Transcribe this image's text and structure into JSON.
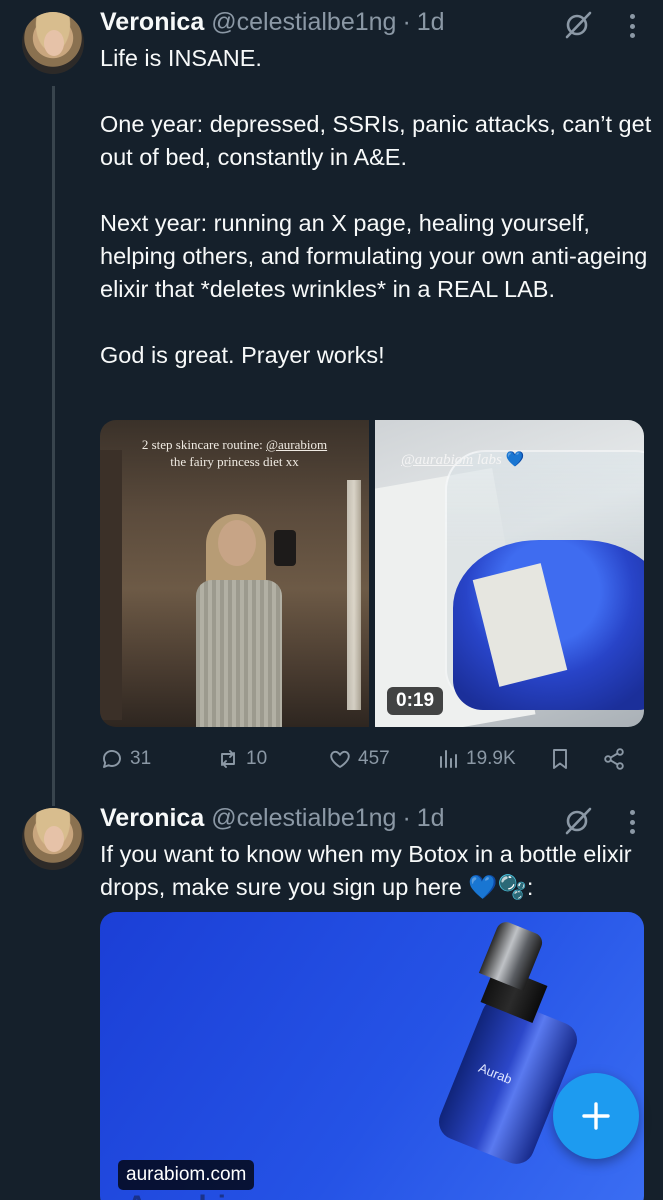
{
  "tweets": [
    {
      "author": {
        "name": "Veronica",
        "handle": "@celestialbe1ng"
      },
      "time": "1d",
      "text": [
        "Life is INSANE.",
        "",
        "One year: depressed, SSRIs, panic attacks, can’t get out of bed, constantly in A&E.",
        "",
        "Next year: running an X page, healing yourself, helping others, and formulating your own anti-ageing elixir that *deletes wrinkles* in a REAL LAB.",
        "",
        "God is great. Prayer works!"
      ],
      "media": {
        "image1_caption_line1_prefix": "2 step skincare routine: ",
        "image1_caption_mention": "@aurabiom",
        "image1_caption_line2": "the fairy princess diet xx",
        "image2_caption_mention": "@aurabiom",
        "image2_caption_suffix": " labs",
        "image2_caption_emoji": "💙",
        "video_duration": "0:19"
      },
      "actions": {
        "replies": "31",
        "reposts": "10",
        "likes": "457",
        "views": "19.9K"
      }
    },
    {
      "author": {
        "name": "Veronica",
        "handle": "@celestialbe1ng"
      },
      "time": "1d",
      "text": [
        "If you want to know when my Botox in a bottle elixir drops, make sure you sign up here 💙🫧:"
      ],
      "card": {
        "domain": "aurabiom.com",
        "wordmark": "Aurabiom",
        "bottle_label": "Aurab"
      }
    }
  ],
  "icons": {
    "grok": "grok-icon",
    "more": "more-options-icon",
    "reply": "reply-icon",
    "repost": "repost-icon",
    "like": "heart-icon",
    "views": "views-icon",
    "bookmark": "bookmark-icon",
    "share": "share-icon",
    "compose": "plus-icon"
  },
  "colors": {
    "background": "#15202b",
    "muted": "#8b98a5",
    "accent": "#1d9bf0",
    "thread_line": "#38444d"
  },
  "ui": {
    "dot": "·"
  }
}
